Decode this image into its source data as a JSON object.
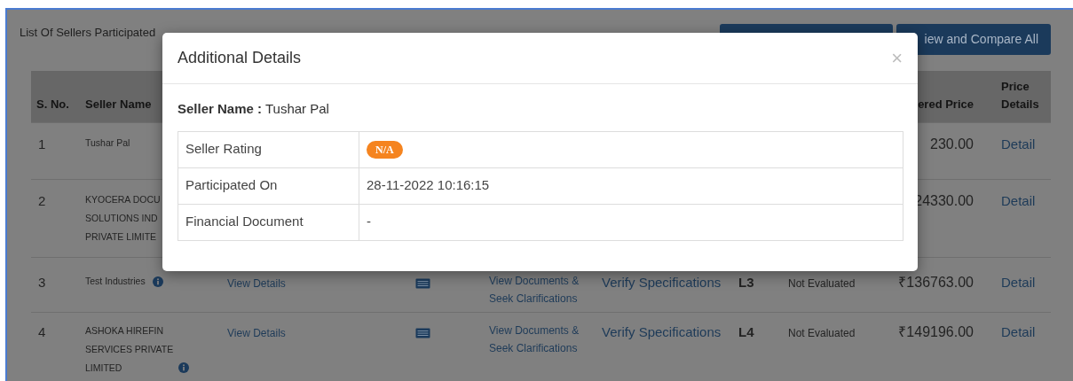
{
  "page": {
    "title": "List Of Sellers Participated",
    "compare_button": "iew and Compare All"
  },
  "table": {
    "columns": [
      {
        "label": "S. No."
      },
      {
        "label": "Seller Name"
      },
      {
        "label": "ered Price"
      },
      {
        "label": "Price Details"
      }
    ],
    "rows": [
      {
        "sno": "1",
        "seller_lines": [
          "Tushar Pal"
        ],
        "info": false,
        "price": "230.00",
        "detail": "Detail"
      },
      {
        "sno": "2",
        "seller_lines": [
          "KYOCERA DOCU",
          "SOLUTIONS IND",
          "PRIVATE LIMITE"
        ],
        "info": false,
        "price": "24330.00",
        "detail": "Detail"
      },
      {
        "sno": "3",
        "seller_lines": [
          "Test Industries"
        ],
        "info": true,
        "view_details": "View Details",
        "documents_icon": true,
        "documents_link": [
          "View Documents &",
          "Seek Clarifications"
        ],
        "verify": "Verify Specifications",
        "rank": "L3",
        "evaluation": "Not Evaluated",
        "price": "₹136763.00",
        "detail": "Detail"
      },
      {
        "sno": "4",
        "seller_lines": [
          "ASHOKA HIREFIN",
          "SERVICES PRIVATE",
          "LIMITED"
        ],
        "info": true,
        "view_details": "View Details",
        "documents_icon": true,
        "documents_link": [
          "View Documents &",
          "Seek Clarifications"
        ],
        "verify": "Verify Specifications",
        "rank": "L4",
        "evaluation": "Not Evaluated",
        "price": "₹149196.00",
        "detail": "Detail"
      }
    ]
  },
  "modal": {
    "title": "Additional Details",
    "close": "×",
    "seller_line": "**Seller Name :** Tushar Pal",
    "rows": [
      {
        "label": "Seller Rating",
        "kind": "badge",
        "value": "N/A"
      },
      {
        "label": "Participated On",
        "kind": "text",
        "value": "28-11-2022 10:16:15"
      },
      {
        "label": "Financial Document",
        "kind": "text",
        "value": "-"
      }
    ]
  }
}
